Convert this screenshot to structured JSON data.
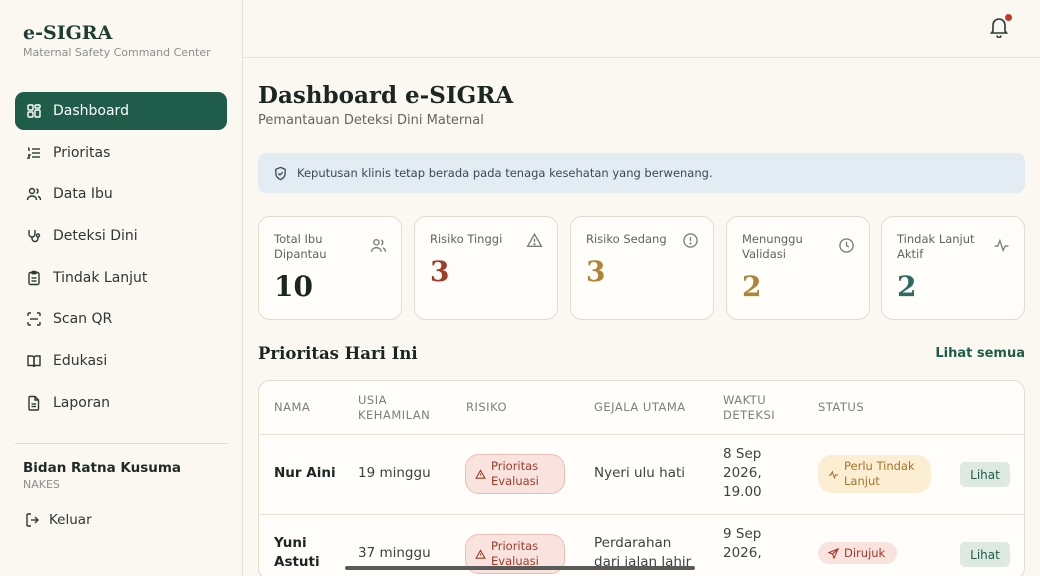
{
  "brand": {
    "title": "e-SIGRA",
    "subtitle": "Maternal Safety Command Center"
  },
  "sidebar": {
    "items": [
      {
        "label": "Dashboard",
        "icon": "grid-icon",
        "active": true
      },
      {
        "label": "Prioritas",
        "icon": "list-ordered-icon"
      },
      {
        "label": "Data Ibu",
        "icon": "users-icon"
      },
      {
        "label": "Deteksi Dini",
        "icon": "stethoscope-icon"
      },
      {
        "label": "Tindak Lanjut",
        "icon": "clipboard-icon"
      },
      {
        "label": "Scan QR",
        "icon": "scan-icon"
      },
      {
        "label": "Edukasi",
        "icon": "book-icon"
      },
      {
        "label": "Laporan",
        "icon": "file-icon"
      }
    ],
    "user": {
      "name": "Bidan Ratna Kusuma",
      "role": "NAKES"
    },
    "logout_label": "Keluar"
  },
  "header": {
    "notifications": "bell-icon"
  },
  "main": {
    "title": "Dashboard e-SIGRA",
    "subtitle": "Pemantauan Deteksi Dini Maternal",
    "notice": "Keputusan klinis tetap berada pada tenaga kesehatan yang berwenang.",
    "stats": [
      {
        "label": "Total Ibu Dipantau",
        "value": "10",
        "color": "#1b2522",
        "icon": "users-icon"
      },
      {
        "label": "Risiko Tinggi",
        "value": "3",
        "color": "#a23a2a",
        "icon": "alert-triangle-icon"
      },
      {
        "label": "Risiko Sedang",
        "value": "3",
        "color": "#b08436",
        "icon": "info-circle-icon"
      },
      {
        "label": "Menunggu Validasi",
        "value": "2",
        "color": "#b08436",
        "icon": "clock-icon"
      },
      {
        "label": "Tindak Lanjut Aktif",
        "value": "2",
        "color": "#2e6b63",
        "icon": "activity-icon"
      }
    ],
    "priority": {
      "title": "Prioritas Hari Ini",
      "see_all": "Lihat semua",
      "columns": [
        "NAMA",
        "USIA KEHAMILAN",
        "RISIKO",
        "GEJALA UTAMA",
        "WAKTU DETEKSI",
        "STATUS"
      ],
      "rows": [
        {
          "name": "Nur Aini",
          "age": "19 minggu",
          "risk": "Prioritas Evaluasi",
          "symptom": "Nyeri ulu hati",
          "time": "8 Sep 2026, 19.00",
          "status": "Perlu Tindak Lanjut",
          "action": "Lihat"
        },
        {
          "name": "Yuni Astuti",
          "age": "37 minggu",
          "risk": "Prioritas Evaluasi",
          "symptom": "Perdarahan dari jalan lahir",
          "time": "9 Sep 2026,",
          "status": "Dirujuk",
          "action": "Lihat"
        }
      ]
    }
  }
}
